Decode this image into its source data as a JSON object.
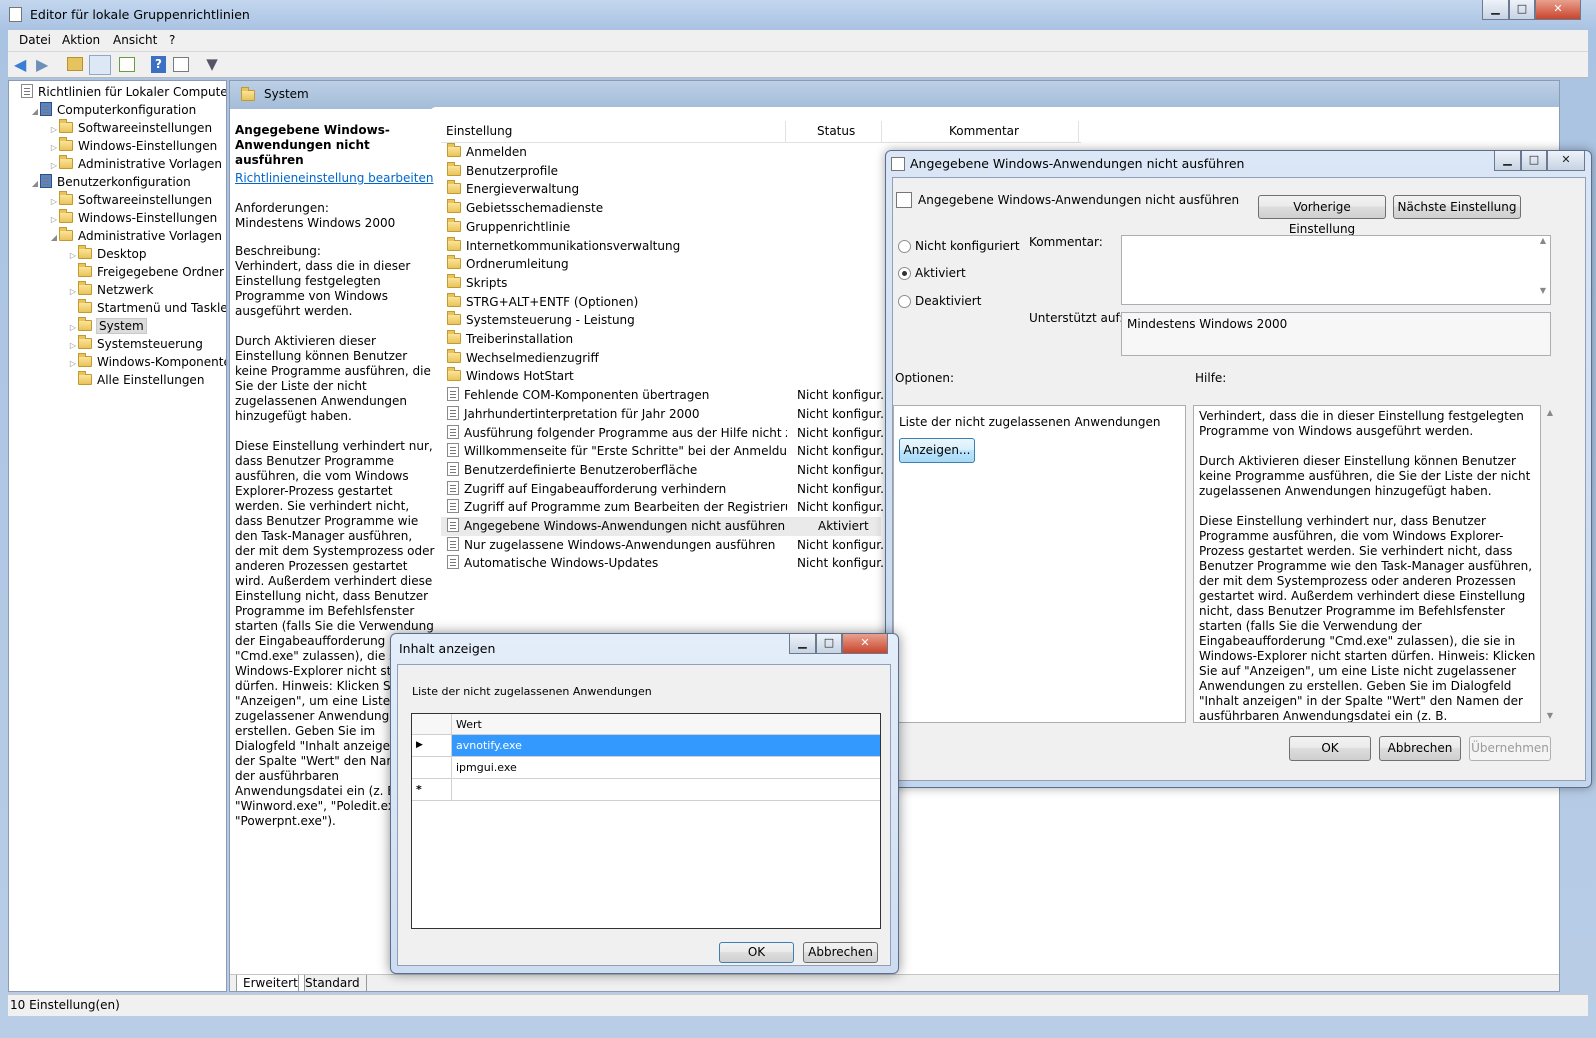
{
  "main_window": {
    "title": "Editor für lokale Gruppenrichtlinien",
    "menu": [
      "Datei",
      "Aktion",
      "Ansicht",
      "?"
    ],
    "status_bar": "10 Einstellung(en)",
    "bottom_tabs": [
      "Erweitert",
      "Standard"
    ]
  },
  "tree": [
    {
      "label": "Richtlinien für Lokaler Computer",
      "level": 0,
      "icon": "computer-policy-icon",
      "expander": ""
    },
    {
      "label": "Computerkonfiguration",
      "level": 1,
      "icon": "computer-icon",
      "expander": "◢"
    },
    {
      "label": "Softwareeinstellungen",
      "level": 2,
      "icon": "folder-icon",
      "expander": "▷"
    },
    {
      "label": "Windows-Einstellungen",
      "level": 2,
      "icon": "folder-icon",
      "expander": "▷"
    },
    {
      "label": "Administrative Vorlagen",
      "level": 2,
      "icon": "folder-icon",
      "expander": "▷"
    },
    {
      "label": "Benutzerkonfiguration",
      "level": 1,
      "icon": "user-icon",
      "expander": "◢"
    },
    {
      "label": "Softwareeinstellungen",
      "level": 2,
      "icon": "folder-icon",
      "expander": "▷"
    },
    {
      "label": "Windows-Einstellungen",
      "level": 2,
      "icon": "folder-icon",
      "expander": "▷"
    },
    {
      "label": "Administrative Vorlagen",
      "level": 2,
      "icon": "folder-icon",
      "expander": "◢"
    },
    {
      "label": "Desktop",
      "level": 3,
      "icon": "folder-icon",
      "expander": "▷"
    },
    {
      "label": "Freigegebene Ordner",
      "level": 3,
      "icon": "folder-icon",
      "expander": ""
    },
    {
      "label": "Netzwerk",
      "level": 3,
      "icon": "folder-icon",
      "expander": "▷"
    },
    {
      "label": "Startmenü und Taskleiste",
      "level": 3,
      "icon": "folder-icon",
      "expander": ""
    },
    {
      "label": "System",
      "level": 3,
      "icon": "folder-icon",
      "expander": "▷",
      "selected": true
    },
    {
      "label": "Systemsteuerung",
      "level": 3,
      "icon": "folder-icon",
      "expander": "▷"
    },
    {
      "label": "Windows-Komponenten",
      "level": 3,
      "icon": "folder-icon",
      "expander": "▷"
    },
    {
      "label": "Alle Einstellungen",
      "level": 3,
      "icon": "settings-folder-icon",
      "expander": ""
    }
  ],
  "content_header": "System",
  "description_pane": {
    "title": "Angegebene Windows-Anwendungen nicht ausführen",
    "edit_link": "Richtlinieneinstellung bearbeiten",
    "requirements": "Anforderungen:\nMindestens Windows 2000",
    "body": "Beschreibung:\nVerhindert, dass die in dieser Einstellung festgelegten Programme von Windows ausgeführt werden.\n\nDurch Aktivieren dieser Einstellung können Benutzer keine Programme ausführen, die Sie der Liste der nicht zugelassenen Anwendungen hinzugefügt haben.\n\nDiese Einstellung verhindert nur, dass Benutzer Programme ausführen, die vom Windows Explorer-Prozess gestartet werden. Sie verhindert nicht, dass Benutzer Programme wie den Task-Manager ausführen, der mit dem Systemprozess oder anderen Prozessen gestartet wird. Außerdem verhindert diese Einstellung nicht, dass Benutzer Programme im Befehlsfenster starten (falls Sie die Verwendung der Eingabeaufforderung \"Cmd.exe\" zulassen), die sie in Windows-Explorer nicht starten dürfen. Hinweis: Klicken Sie auf \"Anzeigen\", um eine Liste nicht zugelassener Anwendungen zu erstellen. Geben Sie im Dialogfeld \"Inhalt anzeigen\" in der Spalte \"Wert\" den Namen der ausführbaren Anwendungsdatei ein (z. B. \"Winword.exe\", \"Poledit.exe\", \"Powerpnt.exe\")."
  },
  "list_columns": [
    "Einstellung",
    "Status",
    "Kommentar"
  ],
  "list_rows": [
    {
      "name": "Anmelden",
      "status": "",
      "type": "folder"
    },
    {
      "name": "Benutzerprofile",
      "status": "",
      "type": "folder"
    },
    {
      "name": "Energieverwaltung",
      "status": "",
      "type": "folder"
    },
    {
      "name": "Gebietsschemadienste",
      "status": "",
      "type": "folder"
    },
    {
      "name": "Gruppenrichtlinie",
      "status": "",
      "type": "folder"
    },
    {
      "name": "Internetkommunikationsverwaltung",
      "status": "",
      "type": "folder"
    },
    {
      "name": "Ordnerumleitung",
      "status": "",
      "type": "folder"
    },
    {
      "name": "Skripts",
      "status": "",
      "type": "folder"
    },
    {
      "name": "STRG+ALT+ENTF (Optionen)",
      "status": "",
      "type": "folder"
    },
    {
      "name": "Systemsteuerung - Leistung",
      "status": "",
      "type": "folder"
    },
    {
      "name": "Treiberinstallation",
      "status": "",
      "type": "folder"
    },
    {
      "name": "Wechselmedienzugriff",
      "status": "",
      "type": "folder"
    },
    {
      "name": "Windows HotStart",
      "status": "",
      "type": "folder"
    },
    {
      "name": "Fehlende COM-Komponenten übertragen",
      "status": "Nicht konfigur...",
      "type": "policy"
    },
    {
      "name": "Jahrhundertinterpretation für Jahr 2000",
      "status": "Nicht konfigur...",
      "type": "policy"
    },
    {
      "name": "Ausführung folgender Programme aus der Hilfe nicht zulass...",
      "status": "Nicht konfigur...",
      "type": "policy"
    },
    {
      "name": "Willkommenseite für \"Erste Schritte\" bei der Anmeldung nic...",
      "status": "Nicht konfigur...",
      "type": "policy"
    },
    {
      "name": "Benutzerdefinierte Benutzeroberfläche",
      "status": "Nicht konfigur...",
      "type": "policy"
    },
    {
      "name": "Zugriff auf Eingabeaufforderung verhindern",
      "status": "Nicht konfigur...",
      "type": "policy"
    },
    {
      "name": "Zugriff auf Programme zum Bearbeiten der Registrierung ve...",
      "status": "Nicht konfigur...",
      "type": "policy"
    },
    {
      "name": "Angegebene Windows-Anwendungen nicht ausführen",
      "status": "Aktiviert",
      "type": "policy",
      "selected": true
    },
    {
      "name": "Nur zugelassene Windows-Anwendungen ausführen",
      "status": "Nicht konfigur...",
      "type": "policy"
    },
    {
      "name": "Automatische Windows-Updates",
      "status": "Nicht konfigur...",
      "type": "policy"
    }
  ],
  "policy_dialog": {
    "title": "Angegebene Windows-Anwendungen nicht ausführen",
    "policy_name": "Angegebene Windows-Anwendungen nicht ausführen",
    "prev_button": "Vorherige Einstellung",
    "next_button": "Nächste Einstellung",
    "radio_not_configured": "Nicht konfiguriert",
    "radio_enabled": "Aktiviert",
    "radio_disabled": "Deaktiviert",
    "selected_radio": "Aktiviert",
    "comment_label": "Kommentar:",
    "comment_value": "",
    "supported_label": "Unterstützt auf:",
    "supported_value": "Mindestens Windows 2000",
    "options_label": "Optionen:",
    "help_label": "Hilfe:",
    "options_list_label": "Liste der nicht zugelassenen Anwendungen",
    "show_button": "Anzeigen...",
    "help_text": "Verhindert, dass die in dieser Einstellung festgelegten Programme von Windows ausgeführt werden.\n\nDurch Aktivieren dieser Einstellung können Benutzer keine Programme ausführen, die Sie der Liste der nicht zugelassenen Anwendungen hinzugefügt haben.\n\nDiese Einstellung verhindert nur, dass Benutzer Programme ausführen, die vom Windows Explorer-Prozess gestartet werden. Sie verhindert nicht, dass Benutzer Programme wie den Task-Manager ausführen, der mit dem Systemprozess oder anderen Prozessen gestartet wird. Außerdem verhindert diese Einstellung nicht, dass Benutzer Programme im Befehlsfenster starten (falls Sie die Verwendung der Eingabeaufforderung \"Cmd.exe\" zulassen), die sie in Windows-Explorer nicht starten dürfen. Hinweis: Klicken Sie auf \"Anzeigen\", um eine Liste nicht zugelassener Anwendungen zu erstellen. Geben Sie im Dialogfeld \"Inhalt anzeigen\" in der Spalte \"Wert\" den Namen der ausführbaren Anwendungsdatei ein (z. B. \"Winword.exe\", \"Poledit.exe\", \"Powerpnt.exe\").",
    "ok_button": "OK",
    "cancel_button": "Abbrechen",
    "apply_button": "Übernehmen"
  },
  "content_dialog": {
    "title": "Inhalt anzeigen",
    "label": "Liste der nicht zugelassenen Anwendungen",
    "column_header": "Wert",
    "rows": [
      "avnotify.exe",
      "ipmgui.exe"
    ],
    "new_row_marker": "*",
    "current_row_marker": "▶",
    "ok_button": "OK",
    "cancel_button": "Abbrechen"
  },
  "colors": {
    "selection": "#3399ff",
    "aero_frame": "#c9d9ee",
    "link": "#0066cc",
    "header_band": "#a9bfd9"
  }
}
